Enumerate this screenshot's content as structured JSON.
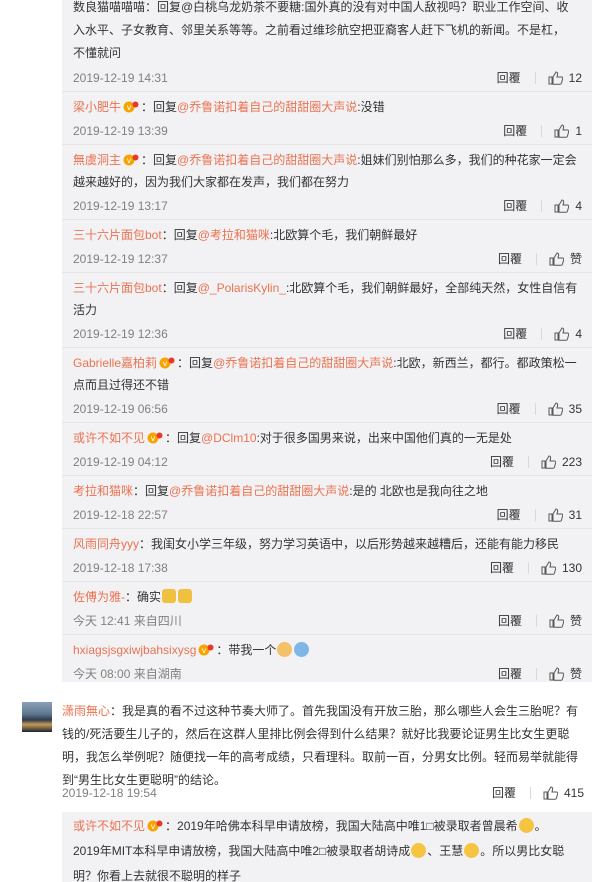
{
  "top_reply": {
    "line1": "数良猫喵喵喵：回复@白桃乌龙奶茶不要糖:国外真的没有对中国人敌视吗？职业工作空间、收",
    "line2": "入水平、子女教育、邻里关系等等。之前看过维珍航空把亚裔客人赶下飞机的新闻。不是杠，",
    "line3": "不懂就问",
    "time": "2019-12-19 14:31",
    "reply": "回覆",
    "likes": "12"
  },
  "replies": [
    {
      "name": "梁小肥牛",
      "prefix": "回复",
      "at": "@乔鲁诺扣着自己的甜甜圈大声说",
      "text": ":没错",
      "time": "2019-12-19 13:39",
      "reply": "回覆",
      "likes": "1"
    },
    {
      "name": "無虞洞主",
      "prefix": "回复",
      "at": "@乔鲁诺扣着自己的甜甜圈大声说",
      "text": ":姐妹们别怕那么多，我们的种花家一定会越来越好的，因为我们大家都在发声，我们都在努力",
      "time": "2019-12-19 13:17",
      "reply": "回覆",
      "likes": "4"
    },
    {
      "name": "三十六片面包bot",
      "prefix": "回复",
      "at": "@考拉和猫咪",
      "text": ":北欧算个毛，我们朝鲜最好",
      "time": "2019-12-19 12:37",
      "reply": "回覆",
      "likes": "赞"
    },
    {
      "name": "三十六片面包bot",
      "prefix": "回复",
      "at": "@_PolarisKylin_",
      "text": ":北欧算个毛，我们朝鲜最好，全部纯天然，女性自信有活力",
      "time": "2019-12-19 12:36",
      "reply": "回覆",
      "likes": "4"
    },
    {
      "name": "Gabrielle嘉柏莉",
      "prefix": "回复",
      "at": "@乔鲁诺扣着自己的甜甜圈大声说",
      "text": ":北欧，新西兰，都行。都政策松一点而且过得还不错",
      "time": "2019-12-19 06:56",
      "reply": "回覆",
      "likes": "35"
    },
    {
      "name": "或许不如不见",
      "prefix": "回复",
      "at": "@DClm10",
      "text": ":对于很多国男来说，出来中国他们真的一无是处",
      "time": "2019-12-19 04:12",
      "reply": "回覆",
      "likes": "223"
    },
    {
      "name": "考拉和猫咪",
      "prefix": "回复",
      "at": "@乔鲁诺扣着自己的甜甜圈大声说",
      "text": ":是的 北欧也是我向往之地",
      "time": "2019-12-18 22:57",
      "reply": "回覆",
      "likes": "31"
    },
    {
      "name": "风雨同舟yyy",
      "prefix": "",
      "at": "",
      "text": "我闺女小学三年级，努力学习英语中，以后形势越来越糟后，还能有能力移民",
      "time": "2019-12-18 17:38",
      "reply": "回覆",
      "likes": "130"
    },
    {
      "name": "佐傅为雅-",
      "prefix": "",
      "at": "",
      "text": "确实",
      "time": "今天 12:41 来自四川",
      "reply": "回覆",
      "likes": "赞"
    },
    {
      "name": "hxiagsjsgxiwjbahsixysg",
      "prefix": "",
      "at": "",
      "text": "带我一个",
      "time": "今天 08:00 来自湖南",
      "reply": "回覆",
      "likes": "赞"
    }
  ],
  "main_comment": {
    "name": "潇雨無心",
    "line1": "我是真的看不过这种节奏大师了。首先我国没有开放三胎，那么哪些人会生三胎呢？有",
    "line2": "钱的/死活要生儿子的，然后在这群人里排比例会得到什么结果？就好比我要论证男生比女生更聪",
    "line3": "明，我怎么举例呢？随便找一年的高考成绩，只看理科。取前一百，分男女比例。轻而易举就能得",
    "line4": "到“男生比女生更聪明”的结论。",
    "time": "2019-12-18 19:54",
    "reply": "回覆",
    "likes": "415"
  },
  "sub_reply": {
    "name": "或许不如不见",
    "line1": "2019年哈佛本科早申请放榜，我国大陆高中唯1□被录取者曾晨希",
    "line2a": "2019年MIT本科早申请放榜，我国大陆高中唯2□被录取者胡诗成",
    "line2b": "、王慧",
    "line2c": "。所以男比女聪",
    "line3": "明？你看上去就很不聪明的样子"
  },
  "colors": {
    "accent": "#eb7350",
    "panel": "#f2f2f5"
  }
}
